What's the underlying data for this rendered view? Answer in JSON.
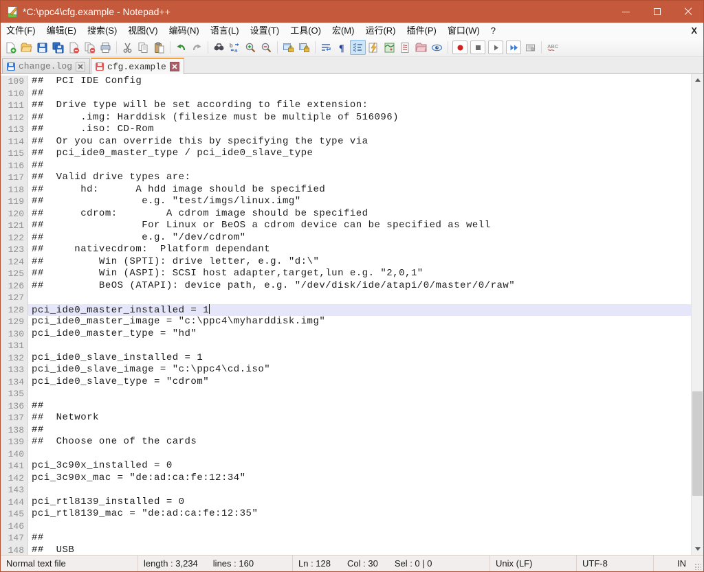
{
  "window": {
    "title": "*C:\\ppc4\\cfg.example - Notepad++"
  },
  "menu": {
    "items": [
      "文件(F)",
      "编辑(E)",
      "搜索(S)",
      "视图(V)",
      "编码(N)",
      "语言(L)",
      "设置(T)",
      "工具(O)",
      "宏(M)",
      "运行(R)",
      "插件(P)",
      "窗口(W)",
      "?"
    ],
    "close": "X"
  },
  "toolbar": {
    "icons": [
      "new-file",
      "open-file",
      "save",
      "save-all",
      "close-file",
      "close-all",
      "print",
      "cut",
      "copy",
      "paste",
      "undo",
      "redo",
      "find",
      "replace",
      "zoom-in",
      "zoom-out",
      "sync-vertical-scroll",
      "sync-horizontal-scroll",
      "word-wrap",
      "show-all-characters",
      "show-indent-guide",
      "udl-dialog",
      "document-map",
      "document-list",
      "folder-as-workspace",
      "file-monitoring",
      "macro-record",
      "macro-stop",
      "macro-play",
      "macro-run-multiple",
      "macro-save",
      "spell-check"
    ]
  },
  "tabs": [
    {
      "title": "change.log",
      "cls": "tab",
      "icon_cls": "tab-floppy saved"
    },
    {
      "title": "cfg.example",
      "cls": "tab active",
      "icon_cls": "tab-floppy modified"
    }
  ],
  "editor": {
    "lines": [
      {
        "num": "109",
        "cls": "line",
        "text": "##  PCI IDE Config"
      },
      {
        "num": "110",
        "cls": "line",
        "text": "##"
      },
      {
        "num": "111",
        "cls": "line",
        "text": "##  Drive type will be set according to file extension:"
      },
      {
        "num": "112",
        "cls": "line",
        "text": "##      .img: Harddisk (filesize must be multiple of 516096)"
      },
      {
        "num": "113",
        "cls": "line",
        "text": "##      .iso: CD-Rom"
      },
      {
        "num": "114",
        "cls": "line",
        "text": "##  Or you can override this by specifying the type via"
      },
      {
        "num": "115",
        "cls": "line",
        "text": "##  pci_ide0_master_type / pci_ide0_slave_type"
      },
      {
        "num": "116",
        "cls": "line",
        "text": "##"
      },
      {
        "num": "117",
        "cls": "line",
        "text": "##  Valid drive types are:"
      },
      {
        "num": "118",
        "cls": "line",
        "text": "##      hd:      A hdd image should be specified"
      },
      {
        "num": "119",
        "cls": "line",
        "text": "##                e.g. \"test/imgs/linux.img\""
      },
      {
        "num": "120",
        "cls": "line",
        "text": "##      cdrom:        A cdrom image should be specified"
      },
      {
        "num": "121",
        "cls": "line",
        "text": "##                For Linux or BeOS a cdrom device can be specified as well"
      },
      {
        "num": "122",
        "cls": "line",
        "text": "##                e.g. \"/dev/cdrom\""
      },
      {
        "num": "123",
        "cls": "line",
        "text": "##     nativecdrom:  Platform dependant"
      },
      {
        "num": "124",
        "cls": "line",
        "text": "##         Win (SPTI): drive letter, e.g. \"d:\\\""
      },
      {
        "num": "125",
        "cls": "line",
        "text": "##         Win (ASPI): SCSI host adapter,target,lun e.g. \"2,0,1\""
      },
      {
        "num": "126",
        "cls": "line",
        "text": "##         BeOS (ATAPI): device path, e.g. \"/dev/disk/ide/atapi/0/master/0/raw\""
      },
      {
        "num": "127",
        "cls": "line",
        "text": ""
      },
      {
        "num": "128",
        "cls": "line current",
        "text": "pci_ide0_master_installed = 1"
      },
      {
        "num": "129",
        "cls": "line",
        "text": "pci_ide0_master_image = \"c:\\ppc4\\myharddisk.img\""
      },
      {
        "num": "130",
        "cls": "line",
        "text": "pci_ide0_master_type = \"hd\""
      },
      {
        "num": "131",
        "cls": "line",
        "text": ""
      },
      {
        "num": "132",
        "cls": "line",
        "text": "pci_ide0_slave_installed = 1"
      },
      {
        "num": "133",
        "cls": "line",
        "text": "pci_ide0_slave_image = \"c:\\ppc4\\cd.iso\""
      },
      {
        "num": "134",
        "cls": "line",
        "text": "pci_ide0_slave_type = \"cdrom\""
      },
      {
        "num": "135",
        "cls": "line",
        "text": ""
      },
      {
        "num": "136",
        "cls": "line",
        "text": "##"
      },
      {
        "num": "137",
        "cls": "line",
        "text": "##  Network"
      },
      {
        "num": "138",
        "cls": "line",
        "text": "##"
      },
      {
        "num": "139",
        "cls": "line",
        "text": "##  Choose one of the cards"
      },
      {
        "num": "140",
        "cls": "line",
        "text": ""
      },
      {
        "num": "141",
        "cls": "line",
        "text": "pci_3c90x_installed = 0"
      },
      {
        "num": "142",
        "cls": "line",
        "text": "pci_3c90x_mac = \"de:ad:ca:fe:12:34\""
      },
      {
        "num": "143",
        "cls": "line",
        "text": ""
      },
      {
        "num": "144",
        "cls": "line",
        "text": "pci_rtl8139_installed = 0"
      },
      {
        "num": "145",
        "cls": "line",
        "text": "pci_rtl8139_mac = \"de:ad:ca:fe:12:35\""
      },
      {
        "num": "146",
        "cls": "line",
        "text": ""
      },
      {
        "num": "147",
        "cls": "line",
        "text": "##"
      },
      {
        "num": "148",
        "cls": "line",
        "text": "##  USB"
      }
    ]
  },
  "status": {
    "doc_type": "Normal text file",
    "length_label": "length : 3,234",
    "lines_label": "lines : 160",
    "ln": "Ln : 128",
    "col": "Col : 30",
    "sel": "Sel : 0 | 0",
    "eol": "Unix (LF)",
    "encoding": "UTF-8",
    "typing_mode": "IN"
  },
  "colors": {
    "titlebar": "#C5593C",
    "active_tab_accent": "#F9A13A",
    "current_line_highlight": "#E6E6FA",
    "modified_tab_icon": "#E05A5A",
    "saved_tab_icon": "#3D7FD6"
  }
}
